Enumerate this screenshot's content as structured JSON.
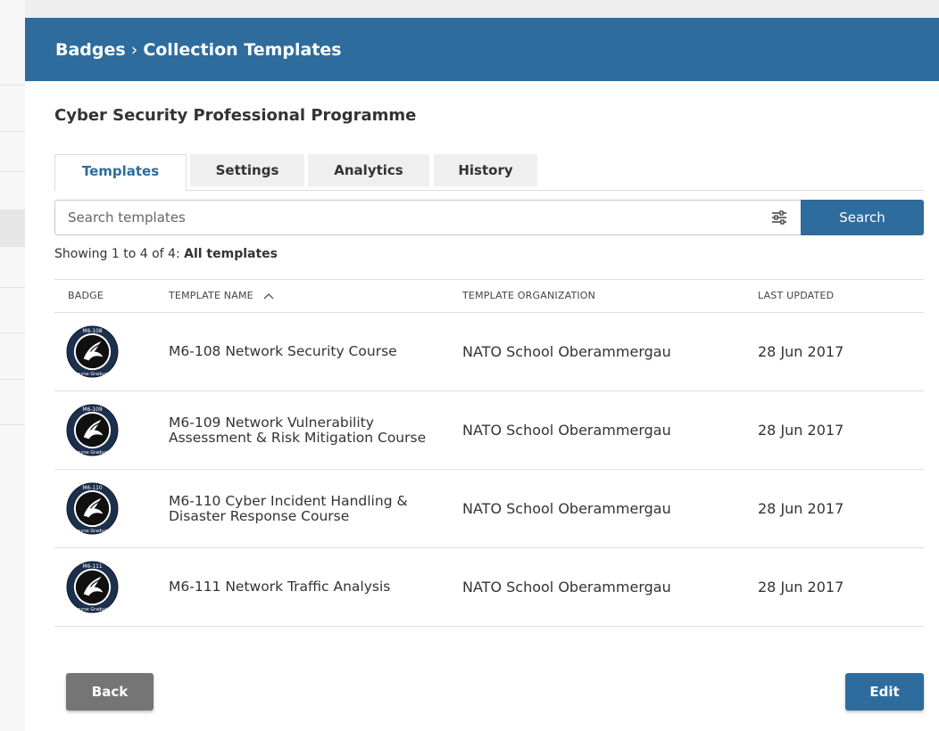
{
  "header": {
    "breadcrumb_root": "Badges",
    "breadcrumb_separator": "›",
    "breadcrumb_current": "Collection Templates"
  },
  "program_title": "Cyber Security Professional Programme",
  "tabs": [
    {
      "label": "Templates",
      "active": true
    },
    {
      "label": "Settings",
      "active": false
    },
    {
      "label": "Analytics",
      "active": false
    },
    {
      "label": "History",
      "active": false
    }
  ],
  "search": {
    "placeholder": "Search templates",
    "value": "",
    "button_label": "Search"
  },
  "showing": {
    "prefix": "Showing 1 to 4 of 4: ",
    "filter": "All templates"
  },
  "table": {
    "columns": [
      "BADGE",
      "TEMPLATE NAME",
      "TEMPLATE ORGANIZATION",
      "LAST UPDATED"
    ],
    "sort_column": "TEMPLATE NAME",
    "sort_direction": "ascending",
    "rows": [
      {
        "badge_code": "M6-108",
        "badge_caption": "Course Graduate",
        "name": "M6-108 Network Security Course",
        "organization": "NATO School Oberammergau",
        "updated": "28 Jun 2017"
      },
      {
        "badge_code": "M6-109",
        "badge_caption": "Course Graduate",
        "name": "M6-109 Network Vulnerability Assessment & Risk Mitigation Course",
        "organization": "NATO School Oberammergau",
        "updated": "28 Jun 2017"
      },
      {
        "badge_code": "M6-110",
        "badge_caption": "Course Graduate",
        "name": "M6-110 Cyber Incident Handling & Disaster Response Course",
        "organization": "NATO School Oberammergau",
        "updated": "28 Jun 2017"
      },
      {
        "badge_code": "M6-111",
        "badge_caption": "Course Graduate",
        "name": "M6-111 Network Traffic Analysis",
        "organization": "NATO School Oberammergau",
        "updated": "28 Jun 2017"
      }
    ]
  },
  "footer": {
    "back_label": "Back",
    "edit_label": "Edit"
  },
  "colors": {
    "primary": "#2e6c9e",
    "back_button": "#757575",
    "badge_bg": "#1c2f4d"
  },
  "icons": {
    "filter": "filter-sliders-icon",
    "sort": "chevron-up-icon",
    "badge": "eagle-badge-icon"
  }
}
